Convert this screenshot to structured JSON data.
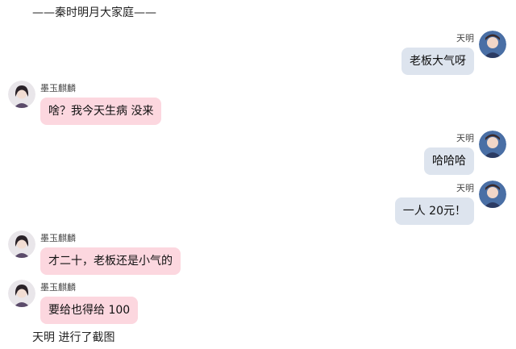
{
  "chat": {
    "header": "——秦时明月大家庭——",
    "system_note": "天明 进行了截图"
  },
  "colors": {
    "left_bubble": "#fcd7df",
    "right_bubble": "#dde4ee"
  },
  "messages": [
    {
      "sender": "天明",
      "side": "right",
      "avatar": "tianming-avatar",
      "text": "老板大气呀"
    },
    {
      "sender": "墨玉麒麟",
      "side": "left",
      "avatar": "moyuqilin-avatar",
      "text": "啥？我今天生病 没来"
    },
    {
      "sender": "天明",
      "side": "right",
      "avatar": "tianming-avatar",
      "text": "哈哈哈"
    },
    {
      "sender": "天明",
      "side": "right",
      "avatar": "tianming-avatar",
      "text": "一人 20元！"
    },
    {
      "sender": "墨玉麒麟",
      "side": "left",
      "avatar": "moyuqilin-avatar",
      "text": "才二十，老板还是小气的"
    },
    {
      "sender": "墨玉麒麟",
      "side": "left",
      "avatar": "moyuqilin-avatar",
      "text": "要给也得给 100"
    }
  ]
}
